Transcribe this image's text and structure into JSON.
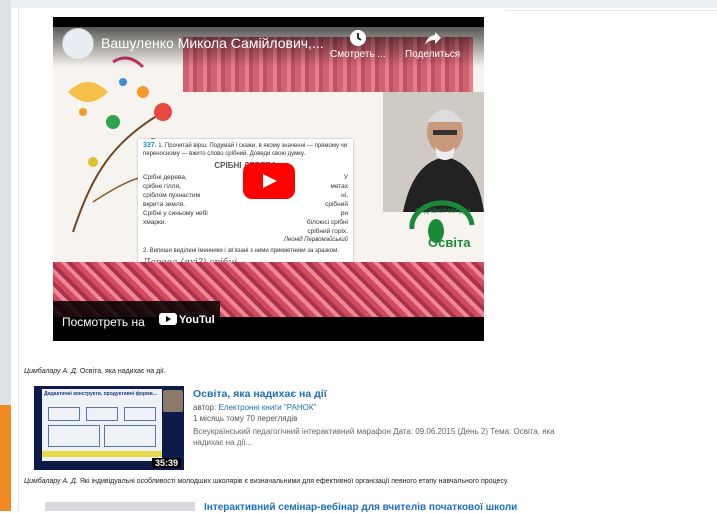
{
  "video": {
    "title": "Вашуленко Микола Самійлович,...",
    "watch_later_label": "Смотреть ...",
    "share_label": "Поделиться",
    "watch_on_label": "Посмотреть на",
    "youtube_label": "YouTube",
    "slide": {
      "exercise_number": "337.",
      "instruction": "1. Прочитай вірш. Подумай і скажи, в якому значенні — прямому чи переносному — вжито слово срібний. Доведи свою думку.",
      "poem_title": "СРІБНІ ДЕРЕВА",
      "col1": [
        "Срібні дерева,",
        "срібне гілля,",
        "сріблом пухнастим",
        "вкрита земля.",
        "Срібні у синьому небі",
        "хмарки."
      ],
      "col2": [
        "У",
        "метах",
        "ні,",
        "срібний",
        "ри",
        "білоюсі срібні",
        "срібний горіх."
      ],
      "poem_author": "Леонід Первомайський",
      "task2": "2. Випиши виділені іменники і зв'язані з ними прикметники за зразком.",
      "handwriting": "Дерева (які?) срібні",
      "logo_text": "Освіта",
      "logo_arc": "ВИДАВНИЧИЙ ДІМ"
    }
  },
  "caption1": {
    "author": "Цимбалару А. Д.",
    "text": " Освіта, яка надихає на дії."
  },
  "related_video": {
    "title": "Освіта, яка надихає на дії",
    "author_prefix": "автор: ",
    "author": "Електронні книги \"РАНОК\"",
    "meta": "1 місяць тому 70 переглядів",
    "description": "Всеукраїнський педагогічний інтерактивний марафон Дата: 09.06.2015 (День 2) Тема: Освіта, яка надихає на дії...",
    "duration": "35:39",
    "thumb_heading": "Дидактичні конструкти, продуктивні форми..."
  },
  "caption2": {
    "author": "Цимбалару А. Д.",
    "text": " Які індивідуальні особливості молодших школярів є визначальними для ефективної організації певного етапу навчального процесу."
  },
  "related_video2": {
    "title": "Інтерактивний семінар-вебінар для вчителів початкової школи"
  }
}
